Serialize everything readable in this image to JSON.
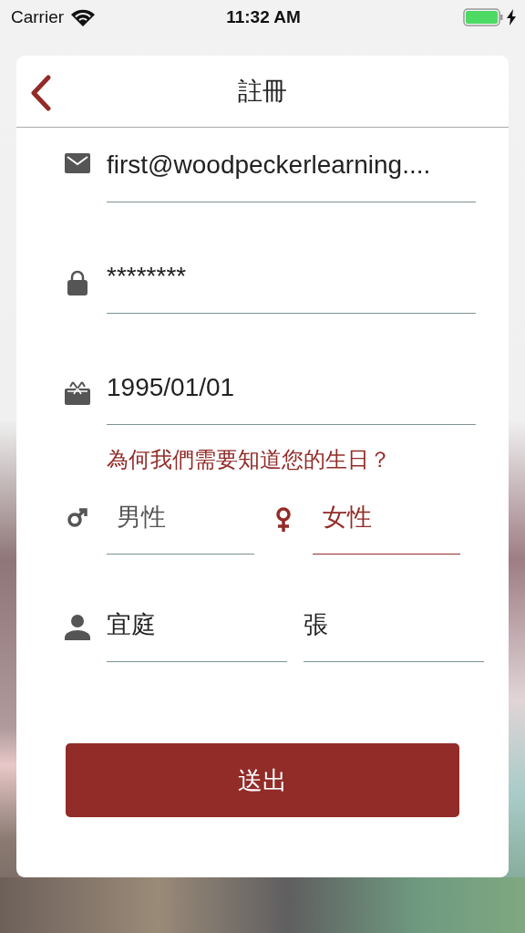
{
  "status_bar": {
    "carrier": "Carrier",
    "time": "11:32 AM"
  },
  "header": {
    "title": "註冊"
  },
  "fields": [
    {
      "kind": "email",
      "value": "first@woodpeckerlearning...."
    },
    {
      "kind": "password",
      "value": "********"
    },
    {
      "kind": "birthday",
      "value": "1995/01/01"
    }
  ],
  "birthday_link": "為何我們需要知道您的生日？",
  "gender_options": [
    {
      "kind": "male",
      "label": "男性",
      "selected": false
    },
    {
      "kind": "female",
      "label": "女性",
      "selected": true
    }
  ],
  "name_fields": [
    {
      "value": "宜庭"
    },
    {
      "value": "張"
    }
  ],
  "submit_button": "送出"
}
